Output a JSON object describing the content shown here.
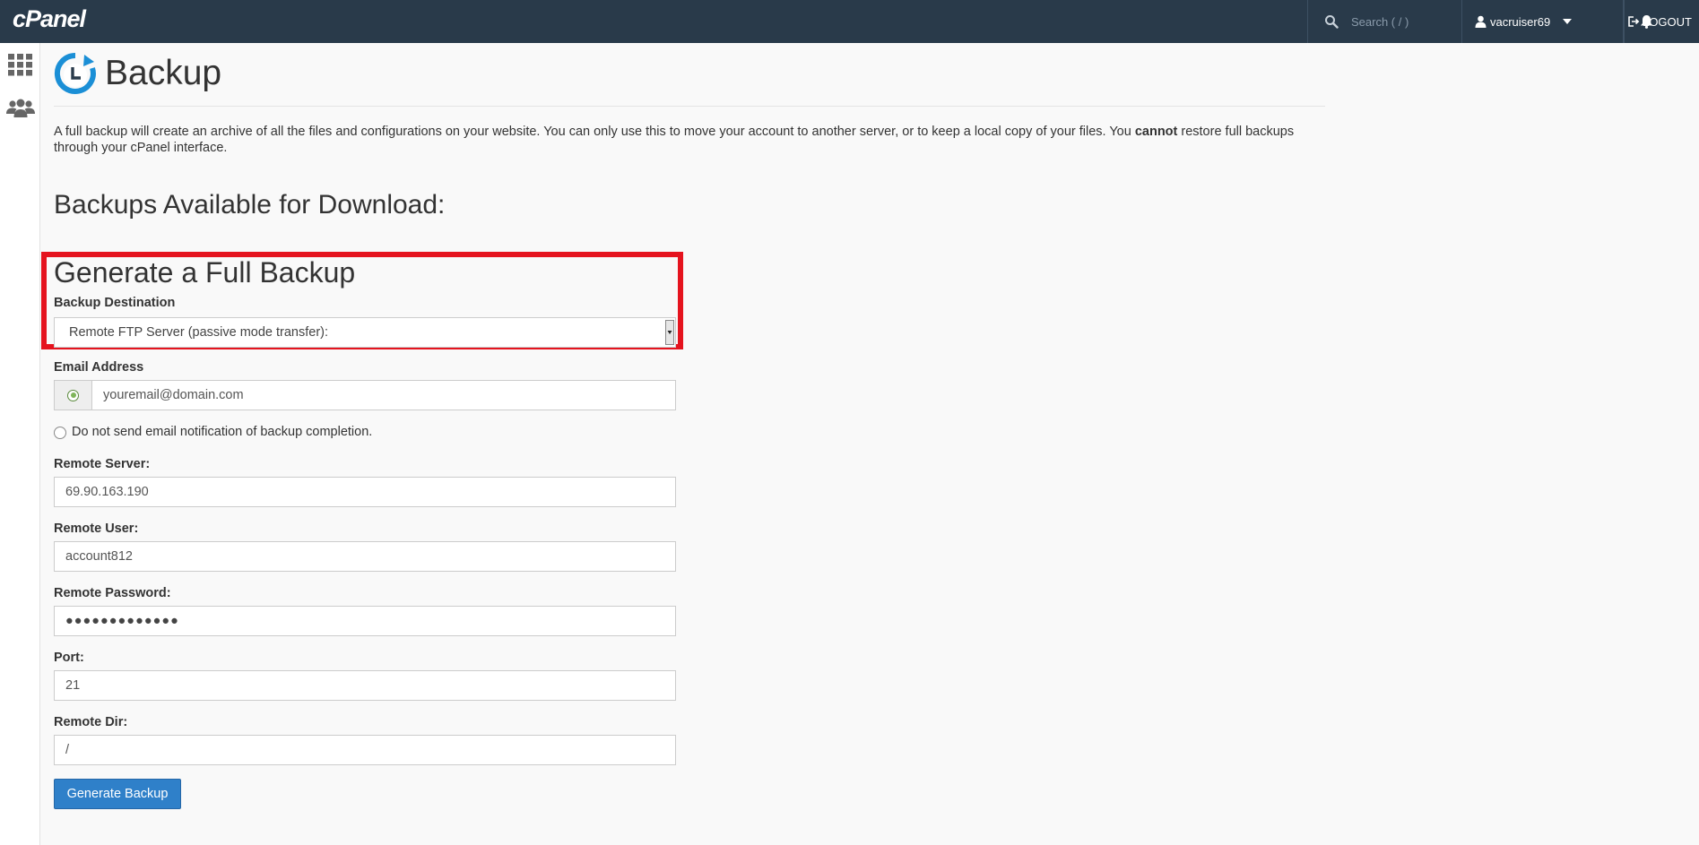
{
  "topbar": {
    "logo": "cPanel",
    "search_placeholder": "Search ( / )",
    "username": "vacruiser69",
    "logout_label": "LOGOUT"
  },
  "page": {
    "title": "Backup",
    "intro_part1": "A full backup will create an archive of all the files and configurations on your website. You can only use this to move your account to another server, or to keep a local copy of your files. You ",
    "intro_bold": "cannot",
    "intro_part2": " restore full backups through your cPanel interface.",
    "available_heading": "Backups Available for Download:"
  },
  "form": {
    "heading": "Generate a Full Backup",
    "destination_label": "Backup Destination",
    "destination_value": "Remote FTP Server (passive mode transfer):",
    "email_label": "Email Address",
    "email_placeholder": "youremail@domain.com",
    "no_email_label": "Do not send email notification of backup completion.",
    "remote_server_label": "Remote Server:",
    "remote_server_value": "69.90.163.190",
    "remote_user_label": "Remote User:",
    "remote_user_value": "account812",
    "remote_password_label": "Remote Password:",
    "remote_password_value": "●●●●●●●●●●●●●",
    "port_label": "Port:",
    "port_value": "21",
    "remote_dir_label": "Remote Dir:",
    "remote_dir_value": "/",
    "submit_label": "Generate Backup"
  },
  "colors": {
    "topbar": "#293a4a",
    "highlight": "#e5131e",
    "button": "#2f80c9",
    "backup_icon": "#1b8fd6"
  }
}
